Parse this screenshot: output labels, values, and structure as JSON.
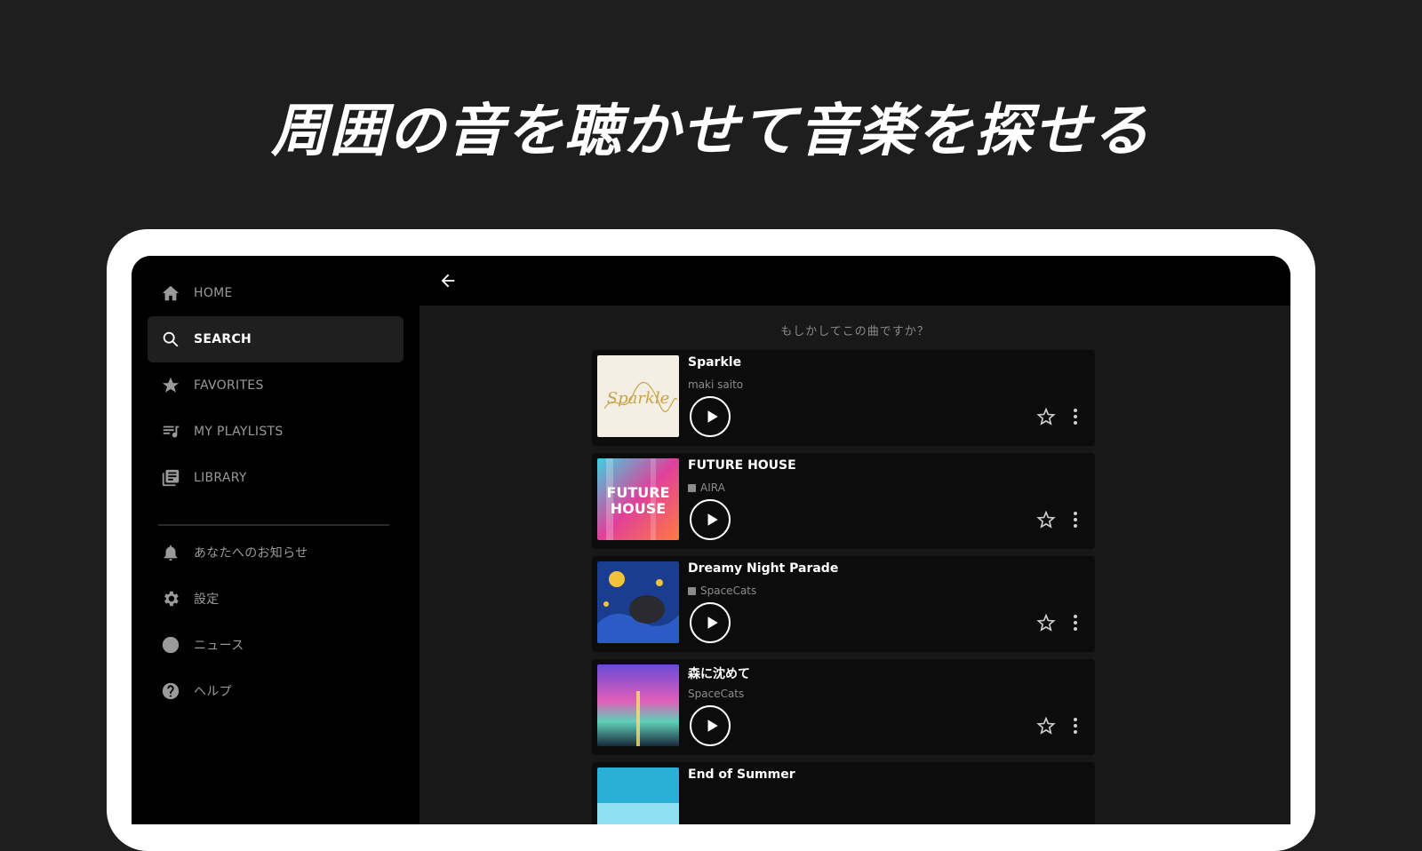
{
  "headline": "周囲の音を聴かせて音楽を探せる",
  "sidebar": {
    "items": [
      {
        "label": "HOME",
        "icon": "home-icon"
      },
      {
        "label": "SEARCH",
        "icon": "search-icon",
        "active": true
      },
      {
        "label": "FAVORITES",
        "icon": "star-icon"
      },
      {
        "label": "MY PLAYLISTS",
        "icon": "playlist-icon"
      },
      {
        "label": "LIBRARY",
        "icon": "library-icon"
      }
    ],
    "secondary": [
      {
        "label": "あなたへのお知らせ",
        "icon": "bell-icon"
      },
      {
        "label": "設定",
        "icon": "gear-icon"
      },
      {
        "label": "ニュース",
        "icon": "news-icon"
      },
      {
        "label": "ヘルプ",
        "icon": "help-icon"
      }
    ]
  },
  "topbar": {
    "back_icon": "arrow-back-icon"
  },
  "results": {
    "prompt": "もしかしてこの曲ですか？",
    "tracks": [
      {
        "title": "Sparkle",
        "artist": "maki saito",
        "verified": false,
        "art_text": "Sparkle"
      },
      {
        "title": "FUTURE HOUSE",
        "artist": "AIRA",
        "verified": true,
        "art_text": "FUTURE HOUSE"
      },
      {
        "title": "Dreamy Night Parade",
        "artist": "SpaceCats",
        "verified": true
      },
      {
        "title": "森に沈めて",
        "artist": "SpaceCats",
        "verified": false
      },
      {
        "title": "End of Summer",
        "artist": "",
        "verified": false
      }
    ]
  },
  "colors": {
    "background": "#1e1e1e",
    "device_frame": "#ffffff",
    "screen": "#000000",
    "card": "#0c0c0c"
  }
}
